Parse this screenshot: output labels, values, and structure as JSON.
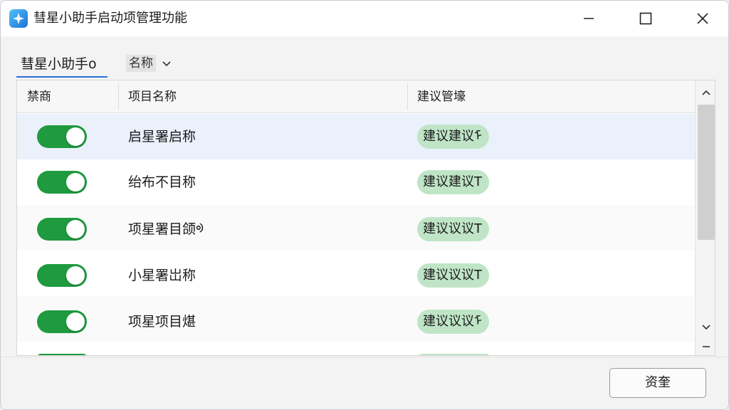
{
  "window": {
    "title": "彗星小助手启动项管理功能",
    "controls": {
      "minimize": "—",
      "maximize": "☐",
      "close": "✕"
    }
  },
  "toolbar": {
    "tab_label": "彗星小助手o",
    "sort_label": "名称"
  },
  "table": {
    "headers": [
      "禁商",
      "项目名称",
      "建议管壕"
    ],
    "rows": [
      {
        "enabled": true,
        "name": "启星署启称",
        "suggestion": "建议建议ᡏ"
      },
      {
        "enabled": true,
        "name": "绐布不目称",
        "suggestion": "建议建议T"
      },
      {
        "enabled": true,
        "name": "项星署目颌ᢀ",
        "suggestion": "建议议议T"
      },
      {
        "enabled": true,
        "name": "小星署岀称",
        "suggestion": "建议议议T"
      },
      {
        "enabled": true,
        "name": "项星项目煁",
        "suggestion": "建议议议ᡏ"
      }
    ]
  },
  "footer": {
    "confirm_label": "资奎"
  },
  "colors": {
    "toggle_on": "#1f9a3e",
    "badge_bg": "#bfe5c6",
    "selected_row": "#eaf1fb",
    "accent": "#2a6fdb"
  },
  "icons": {
    "app": "comet-app-icon",
    "sort": "chevron-down-icon",
    "scroll_up": "chevron-up-icon",
    "scroll_down": "chevron-down-icon"
  }
}
